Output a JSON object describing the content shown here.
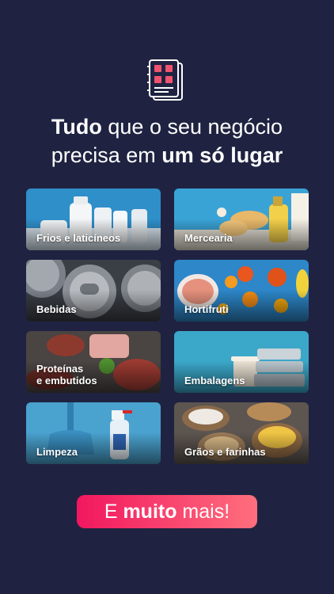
{
  "header": {
    "icon": "catalog-icon",
    "headline_line1_bold": "Tudo",
    "headline_line1_rest": " que o seu negócio",
    "headline_line2_start": "precisa em ",
    "headline_line2_bold": "um só lugar"
  },
  "categories": [
    {
      "label": "Frios e laticíneos"
    },
    {
      "label": "Mercearia"
    },
    {
      "label": "Bebidas"
    },
    {
      "label": "Hortifruti"
    },
    {
      "label": "Proteínas\ne embutidos"
    },
    {
      "label": "Embalagens"
    },
    {
      "label": "Limpeza"
    },
    {
      "label": "Grãos e farinhas"
    }
  ],
  "cta": {
    "prefix": "E ",
    "bold": "muito",
    "suffix": " mais!"
  },
  "colors": {
    "background": "#1f2341",
    "cta_start": "#f2175f",
    "cta_end": "#ff6f7d",
    "icon_accent": "#f0536d"
  }
}
